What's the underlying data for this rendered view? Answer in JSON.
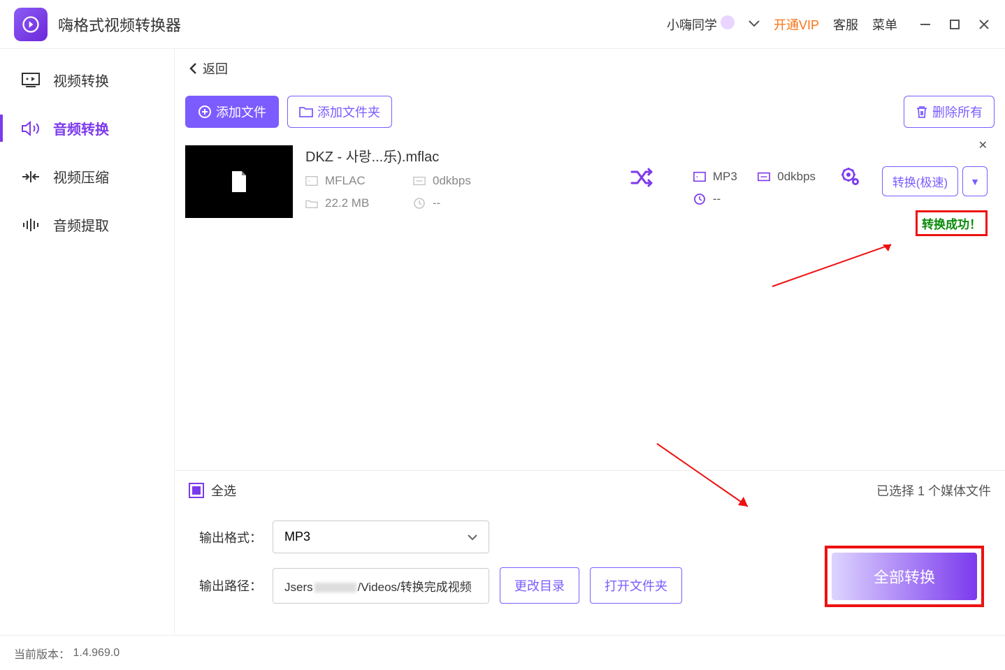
{
  "app": {
    "title": "嗨格式视频转换器"
  },
  "titlebar": {
    "user": "小嗨同学",
    "vip": "开通VIP",
    "support": "客服",
    "menu": "菜单"
  },
  "sidebar": {
    "items": [
      {
        "label": "视频转换"
      },
      {
        "label": "音频转换"
      },
      {
        "label": "视频压缩"
      },
      {
        "label": "音频提取"
      }
    ]
  },
  "back": {
    "label": "返回"
  },
  "toolbar": {
    "add_file": "添加文件",
    "add_folder": "添加文件夹",
    "delete_all": "删除所有"
  },
  "file": {
    "name": "DKZ - 사랑...乐).mflac",
    "in_format": "MFLAC",
    "in_bitrate": "0dkbps",
    "in_size": "22.2 MB",
    "in_duration": "--",
    "out_format": "MP3",
    "out_bitrate": "0dkbps",
    "out_duration": "--",
    "convert_label": "转换(极速)",
    "success": "转换成功！"
  },
  "bottom": {
    "select_all": "全选",
    "selected_text_prefix": "已选择 ",
    "selected_count": "1",
    "selected_text_suffix": " 个媒体文件",
    "output_format_label": "输出格式：",
    "output_format_value": "MP3",
    "output_path_label": "输出路径：",
    "output_path_prefix": "Jsers",
    "output_path_suffix": "/Videos/转换完成视频",
    "change_dir": "更改目录",
    "open_folder": "打开文件夹",
    "convert_all": "全部转换"
  },
  "footer": {
    "version_label": "当前版本：",
    "version": "1.4.969.0"
  }
}
